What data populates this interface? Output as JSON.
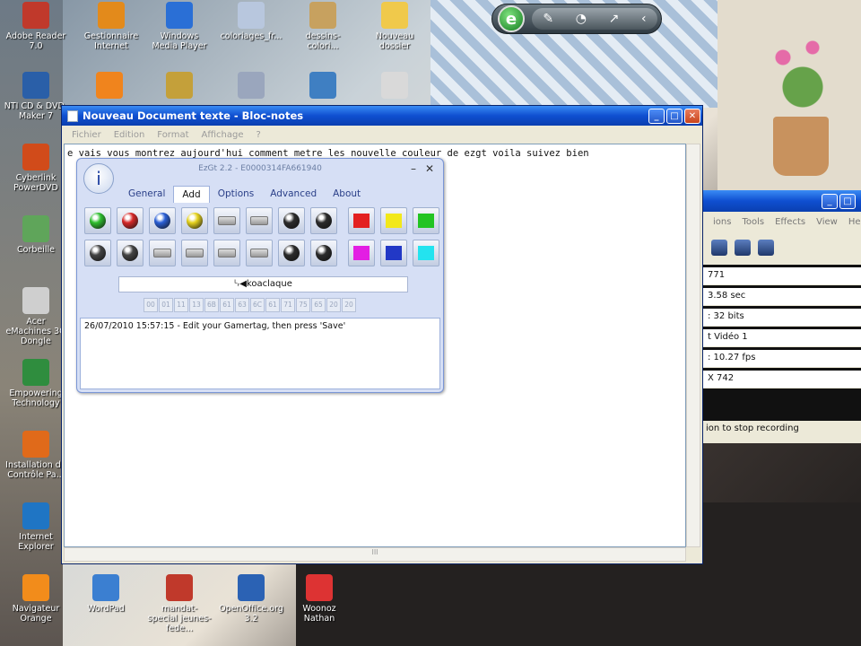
{
  "desktop": {
    "icons": [
      {
        "label": "Adobe Reader 7.0",
        "icon": "pdf-icon",
        "color": "#c0392b"
      },
      {
        "label": "Gestionnaire Internet",
        "icon": "manager-icon",
        "color": "#e38a1b"
      },
      {
        "label": "Windows Media Player",
        "icon": "media-player-icon",
        "color": "#2a6fd6"
      },
      {
        "label": "coloriages_fr...",
        "icon": "file-icon",
        "color": "#b8c7de"
      },
      {
        "label": "dessins-colori...",
        "icon": "image-icon",
        "color": "#c7a15f"
      },
      {
        "label": "Nouveau dossier",
        "icon": "folder-icon",
        "color": "#f0c94b"
      },
      {
        "label": "NTI CD & DVD-Maker 7",
        "icon": "disc-icon",
        "color": "#2a5fa8"
      },
      {
        "label": "",
        "icon": "vlc-icon",
        "color": "#f0841d"
      },
      {
        "label": "",
        "icon": "winamp-icon",
        "color": "#c4a03a"
      },
      {
        "label": "",
        "icon": "document-icon",
        "color": "#9aa6bd"
      },
      {
        "label": "",
        "icon": "globe-icon",
        "color": "#3f7fc2"
      },
      {
        "label": "",
        "icon": "text-file-icon",
        "color": "#d9d9d9"
      },
      {
        "label": "Cyberlink PowerDVD",
        "icon": "dvd-icon",
        "color": "#d14b1a"
      },
      {
        "label": "Corbeille",
        "icon": "recycle-bin-icon",
        "color": "#5fa55a"
      },
      {
        "label": "Acer eMachines 3G Dongle",
        "icon": "dongle-icon",
        "color": "#cfcfcf"
      },
      {
        "label": "Empowering Technology",
        "icon": "empowering-icon",
        "color": "#2f8d3e"
      },
      {
        "label": "Installation du Contrôle Pa...",
        "icon": "parental-control-icon",
        "color": "#e06a1a"
      },
      {
        "label": "Internet Explorer",
        "icon": "internet-explorer-icon",
        "color": "#1f75c4"
      },
      {
        "label": "Navigateur Orange",
        "icon": "star-icon",
        "color": "#f28c1b"
      },
      {
        "label": "WordPad",
        "icon": "wordpad-icon",
        "color": "#3b7fd1"
      },
      {
        "label": "mandat-special jeunes-fede...",
        "icon": "pdf-icon",
        "color": "#c0392b"
      },
      {
        "label": "OpenOffice.org 3.2",
        "icon": "openoffice-icon",
        "color": "#2b62b4"
      },
      {
        "label": "Woonoz Nathan",
        "icon": "woonoz-icon",
        "color": "#d33"
      }
    ]
  },
  "sidebar_gadget": {
    "badge": "e",
    "icons": [
      "✎",
      "◔",
      "↗",
      "‹"
    ]
  },
  "notepad": {
    "title": "Nouveau Document texte - Bloc-notes",
    "menu": [
      "Fichier",
      "Edition",
      "Format",
      "Affichage",
      "?"
    ],
    "content": "e vais vous montrez aujourd'hui comment metre les nouvelle couleur de ezgt voila suivez bien",
    "buttons": {
      "minimize": "_",
      "maximize": "□",
      "close": "✕"
    },
    "hscroll": "III"
  },
  "ezgt": {
    "title": "EzGt 2.2 - E0000314FA661940",
    "controls": {
      "minimize": "–",
      "close": "✕"
    },
    "logo_glyph": "i",
    "tabs": [
      "General",
      "Add",
      "Options",
      "Advanced",
      "About"
    ],
    "active_tab": "Add",
    "buttons": [
      {
        "name": "green-orb-button",
        "kind": "orb",
        "color": "#2fbf2f"
      },
      {
        "name": "red-orb-button",
        "kind": "orb",
        "color": "#d62828"
      },
      {
        "name": "blue-orb-button",
        "kind": "orb",
        "color": "#2a5fd6"
      },
      {
        "name": "yellow-orb-button",
        "kind": "orb",
        "color": "#e5d21e"
      },
      {
        "name": "lb-button",
        "kind": "chip",
        "color": "#aaaaaa"
      },
      {
        "name": "rb-button",
        "kind": "chip",
        "color": "#aaaaaa"
      },
      {
        "name": "left-stick-button",
        "kind": "orb",
        "color": "#2b2b2b"
      },
      {
        "name": "right-stick-button",
        "kind": "orb",
        "color": "#2b2b2b"
      },
      {
        "name": "red-color-button",
        "kind": "sq",
        "color": "#e32020"
      },
      {
        "name": "yellow-color-button",
        "kind": "sq",
        "color": "#f2e81a"
      },
      {
        "name": "green-color-button",
        "kind": "sq",
        "color": "#22c422"
      },
      {
        "name": "dpad-left-button",
        "kind": "orb",
        "color": "#444444"
      },
      {
        "name": "dpad-right-button",
        "kind": "orb",
        "color": "#444444"
      },
      {
        "name": "left-trigger-button",
        "kind": "chip",
        "color": "#bbbbbb"
      },
      {
        "name": "right-trigger-button",
        "kind": "chip",
        "color": "#bbbbbb"
      },
      {
        "name": "back-button",
        "kind": "chip",
        "color": "#cccccc"
      },
      {
        "name": "start-button",
        "kind": "chip",
        "color": "#cccccc"
      },
      {
        "name": "guide-left-button",
        "kind": "orb",
        "color": "#2b2b2b"
      },
      {
        "name": "guide-right-button",
        "kind": "orb",
        "color": "#2b2b2b"
      },
      {
        "name": "magenta-color-button",
        "kind": "sq",
        "color": "#e31ee3"
      },
      {
        "name": "blue-color-button",
        "kind": "sq",
        "color": "#2238c6"
      },
      {
        "name": "cyan-color-button",
        "kind": "sq",
        "color": "#23e3ef"
      }
    ],
    "gamertag": "koaclaque",
    "gamertag_prefix": "ᴸᵣ◀",
    "hex_codes": [
      "00",
      "01",
      "11",
      "13",
      "6B",
      "61",
      "63",
      "6C",
      "61",
      "71",
      "75",
      "65",
      "20",
      "20"
    ],
    "log": "26/07/2010 15:57:15 - Edit your Gamertag, then press 'Save'"
  },
  "recorder": {
    "menu": [
      "ions",
      "Tools",
      "Effects",
      "View",
      "Help"
    ],
    "rows": [
      "771",
      "3.58 sec",
      ": 32 bits",
      "t Vidéo 1",
      ": 10.27 fps",
      "X 742"
    ],
    "status": "ion to stop recording"
  }
}
